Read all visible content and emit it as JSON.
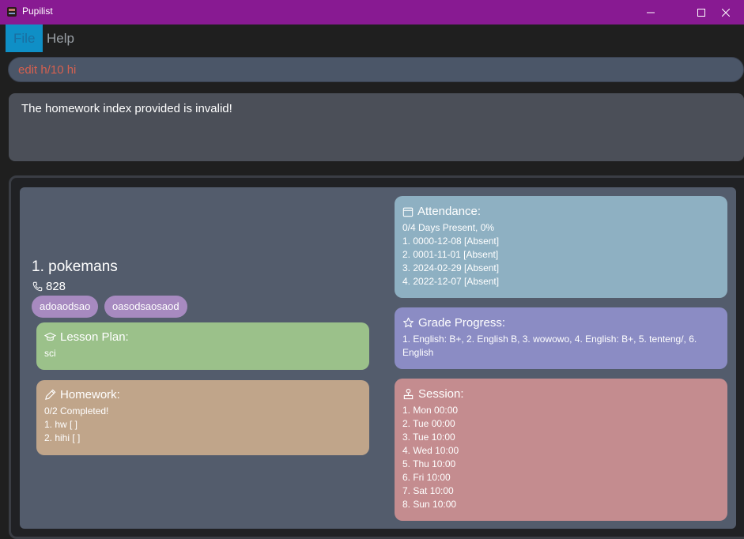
{
  "window": {
    "title": "Pupilist"
  },
  "menu": {
    "file": "File",
    "help": "Help"
  },
  "command": {
    "value": "edit h/10 hi"
  },
  "result": {
    "message": "The homework index provided is invalid!"
  },
  "person": {
    "name": "1.  pokemans",
    "phone": "828",
    "tags": [
      "adoaodsao",
      "oasodsaosaod"
    ],
    "lesson_plan": {
      "title": "Lesson Plan:",
      "lines": [
        "sci"
      ]
    },
    "homework": {
      "title": "Homework:",
      "lines": [
        "0/2 Completed!",
        "1. hw [ ]",
        "2. hihi [ ]"
      ]
    },
    "attendance": {
      "title": "Attendance:",
      "lines": [
        "0/4 Days Present, 0%",
        "1. 0000-12-08 [Absent]",
        "2. 0001-11-01 [Absent]",
        "3. 2024-02-29 [Absent]",
        "4. 2022-12-07 [Absent]"
      ]
    },
    "grade_progress": {
      "title": "Grade Progress:",
      "text": "1. English: B+, 2. English B, 3. wowowo, 4. English: B+, 5. tenteng/, 6. English"
    },
    "session": {
      "title": "Session:",
      "lines": [
        "1. Mon 00:00",
        "2. Tue 00:00",
        "3. Tue 10:00",
        "4. Wed 10:00",
        "5. Thu 10:00",
        "6. Fri 10:00",
        "7. Sat 10:00",
        "8. Sun 10:00"
      ]
    }
  },
  "colors": {
    "titlebar": "#881a92",
    "menu_file_highlight": "#0f8fc6",
    "command_text": "#d6604f",
    "card": "#535c6c",
    "lesson": "#9bc18a",
    "homework": "#c0a58a",
    "attendance": "#8eb0c2",
    "grade": "#8b8cc4",
    "session": "#c48c8f",
    "tag": "#a78ac0"
  }
}
